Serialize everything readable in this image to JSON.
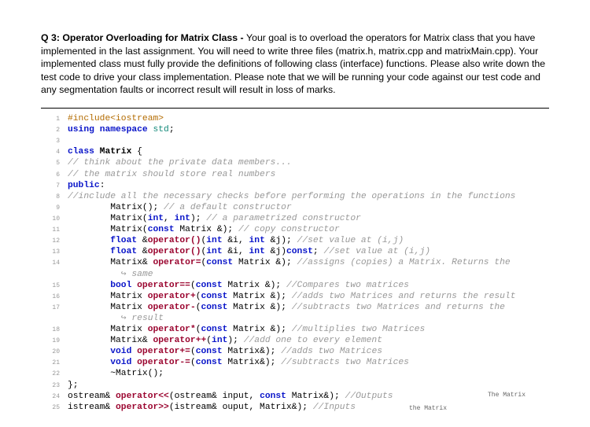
{
  "prompt": {
    "title_bold": "Q 3: Operator Overloading for Matrix Class - ",
    "body": "Your goal is to overload the operators for Matrix class that you have implemented in the last assignment. You will need to write three files (matrix.h, matrix.cpp and matrixMain.cpp). Your implemented class must fully provide the definitions of following class (interface) functions. Please also write down the test code to drive your class implementation. Please note that we will be running your code against our test code and any segmentation faults or incorrect result will result in loss of marks."
  },
  "code": {
    "l1": {
      "pp1": "#include",
      "pp2": "<iostream>"
    },
    "l2": {
      "kw1": "using",
      "kw2": "namespace",
      "id": " std",
      "semi": ";"
    },
    "l4": {
      "kw": "class",
      "name": " Matrix",
      "brc": " {"
    },
    "l5": {
      "cm": "// think about the private data members..."
    },
    "l6": {
      "cm": "// the matrix should store real numbers"
    },
    "l7": {
      "kw": "public",
      "colon": ":"
    },
    "l8": {
      "cm": "//include all the necessary checks before performing the operations in the functions"
    },
    "l9": {
      "sig": "Matrix();",
      "cm": " // a default constructor"
    },
    "l10": {
      "sig1": "Matrix(",
      "t1": "int",
      "c": ", ",
      "t2": "int",
      "sig2": ");",
      "cm": " // a parametrized constructor"
    },
    "l11": {
      "sig1": "Matrix(",
      "kw": "const",
      "sig2": " Matrix &);",
      "cm": " // copy constructor"
    },
    "l12": {
      "t": "float ",
      "amp": "&",
      "op": "operator",
      "par": "()",
      "args": "(",
      "t1": "int",
      "a1": " &i, ",
      "t2": "int",
      "a2": " &j);",
      "cm": " //set value at (i,j)"
    },
    "l13": {
      "t": "float ",
      "amp": "&",
      "op": "operator",
      "par": "()",
      "args": "(",
      "t1": "int",
      "a1": " &i, ",
      "t2": "int",
      "a2": " &j)",
      "cst": "const",
      "semi": ";",
      "cm": " //set value at (i,j)"
    },
    "l14": {
      "r": "Matrix& ",
      "op": "operator",
      "sym": "=",
      "args": "(",
      "kw": "const",
      "r2": " Matrix &);",
      "cm": " //assigns (copies) a Matrix. Returns the"
    },
    "l14b": {
      "arrow": "↪ ",
      "cm": "same"
    },
    "l15": {
      "r": "bool ",
      "op": "operator",
      "sym": "==",
      "args": "(",
      "kw": "const",
      "r2": " Matrix &);",
      "cm": " //Compares two matrices"
    },
    "l16": {
      "r": "Matrix ",
      "op": "operator",
      "sym": "+",
      "args": "(",
      "kw": "const",
      "r2": " Matrix &);",
      "cm": " //adds two Matrices and returns the result"
    },
    "l17": {
      "r": "Matrix ",
      "op": "operator",
      "sym": "-",
      "args": "(",
      "kw": "const",
      "r2": " Matrix &);",
      "cm": " //subtracts two Matrices and returns the"
    },
    "l17b": {
      "arrow": "↪ ",
      "cm": "result"
    },
    "l18": {
      "r": "Matrix ",
      "op": "operator",
      "sym": "*",
      "args": "(",
      "kw": "const",
      "r2": " Matrix &);",
      "cm": " //multiplies two Matrices"
    },
    "l19": {
      "r": "Matrix& ",
      "op": "operator",
      "sym": "++",
      "args": "(",
      "t1": "int",
      "r2": ");",
      "cm": " //add one to every element"
    },
    "l20": {
      "r": "void ",
      "op": "operator",
      "sym": "+=",
      "args": "(",
      "kw": "const",
      "r2": " Matrix&);",
      "cm": " //adds two Matrices"
    },
    "l21": {
      "r": "void ",
      "op": "operator",
      "sym": "-=",
      "args": "(",
      "kw": "const",
      "r2": " Matrix&);",
      "cm": " //subtracts two Matrices"
    },
    "l22": {
      "r": "~Matrix();"
    },
    "l23": {
      "r": "};"
    },
    "l24": {
      "r1": "ostream& ",
      "op": "operator",
      "sym": "<<",
      "args": "(ostream& input, ",
      "kw": "const",
      "r2": " Matrix&);",
      "cm": " //Outputs"
    },
    "l25": {
      "r1": "istream& ",
      "op": "operator",
      "sym": ">>",
      "args": "(istream& ouput, Matrix&);",
      "cm": " //Inputs"
    }
  },
  "notes": {
    "note24": "The Matrix",
    "note25": "the Matrix"
  }
}
